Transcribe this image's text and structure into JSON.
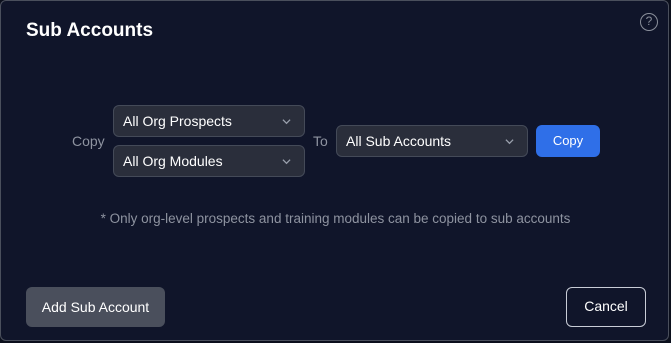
{
  "dialog": {
    "title": "Sub Accounts",
    "help_icon": "help-circle-icon",
    "help_glyph": "?"
  },
  "copy_row": {
    "copy_label": "Copy",
    "to_label": "To",
    "source_prospects": {
      "selected": "All Org Prospects"
    },
    "source_modules": {
      "selected": "All Org Modules"
    },
    "target_accounts": {
      "selected": "All Sub Accounts"
    },
    "copy_button_label": "Copy"
  },
  "note": "* Only org-level prospects and training modules can be copied to sub accounts",
  "footer": {
    "add_button_label": "Add Sub Account",
    "cancel_button_label": "Cancel"
  },
  "colors": {
    "background": "#10152a",
    "primary": "#2f6fe8",
    "secondary_button": "#4a4f5c",
    "muted_text": "#8e93a0"
  }
}
